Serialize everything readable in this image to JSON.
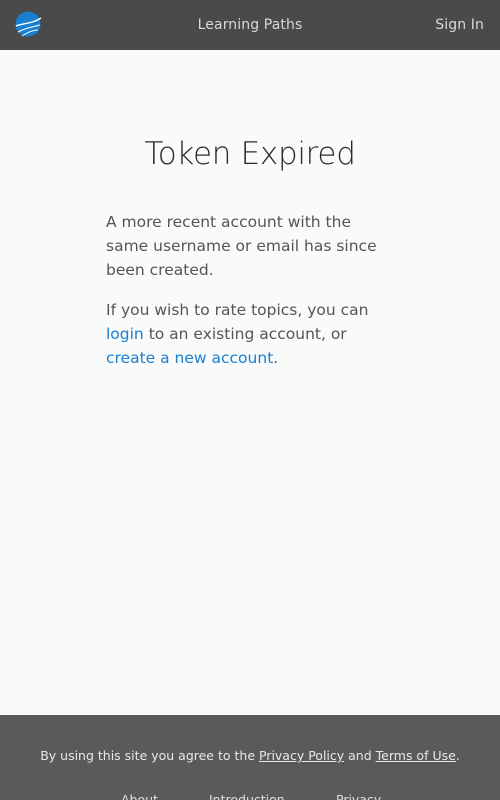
{
  "header": {
    "logo_icon": "globe-logo-icon",
    "nav_center": "Learning Paths",
    "sign_in": "Sign In"
  },
  "main": {
    "title": "Token Expired",
    "paragraph1": "A more recent account with the same username or email has since been created.",
    "paragraph2_prefix": "If you wish to rate topics, you can ",
    "login_link": "login",
    "paragraph2_middle": " to an existing account, or ",
    "create_link": "create a new account",
    "paragraph2_suffix": "."
  },
  "footer": {
    "consent_prefix": "By using this site you agree to the ",
    "privacy_policy_link": "Privacy Policy",
    "consent_and": " and ",
    "terms_link": "Terms of Use",
    "consent_suffix": ".",
    "links": [
      "About",
      "Introduction",
      "Privacy"
    ]
  },
  "colors": {
    "header_bg": "#4a4a4a",
    "footer_bg": "#5a5a5a",
    "link": "#1a7fd0",
    "logo": "#1a7fd0"
  }
}
